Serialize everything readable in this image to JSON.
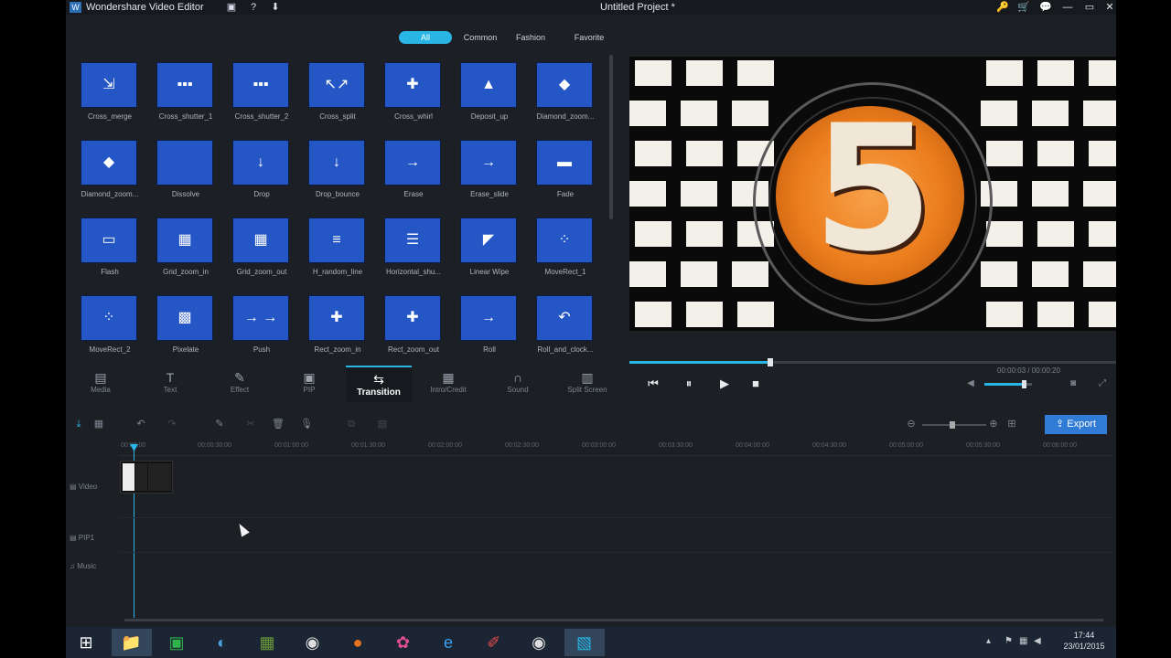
{
  "titlebar": {
    "app_name": "Wondershare Video Editor",
    "project": "Untitled Project *",
    "right_buttons": [
      "🔑",
      "🛒",
      "💬",
      "—",
      "▭",
      "✕"
    ]
  },
  "filters": [
    "All",
    "Common",
    "Fashion",
    "Favorite"
  ],
  "active_filter": "All",
  "transitions": [
    {
      "label": "Cross_merge",
      "glyph": "⇲"
    },
    {
      "label": "Cross_shutter_1",
      "glyph": "▪▪▪"
    },
    {
      "label": "Cross_shutter_2",
      "glyph": "▪▪▪"
    },
    {
      "label": "Cross_split",
      "glyph": "↖↗"
    },
    {
      "label": "Cross_whirl",
      "glyph": "✚"
    },
    {
      "label": "Deposit_up",
      "glyph": "▲"
    },
    {
      "label": "Diamond_zoom...",
      "glyph": "◆"
    },
    {
      "label": "Diamond_zoom...",
      "glyph": "◆"
    },
    {
      "label": "Dissolve",
      "glyph": ""
    },
    {
      "label": "Drop",
      "glyph": "↓"
    },
    {
      "label": "Drop_bounce",
      "glyph": "↓"
    },
    {
      "label": "Erase",
      "glyph": "→"
    },
    {
      "label": "Erase_slide",
      "glyph": "→"
    },
    {
      "label": "Fade",
      "glyph": "▬"
    },
    {
      "label": "Flash",
      "glyph": "▭"
    },
    {
      "label": "Grid_zoom_in",
      "glyph": "▦"
    },
    {
      "label": "Grid_zoom_out",
      "glyph": "▦"
    },
    {
      "label": "H_random_line",
      "glyph": "≡"
    },
    {
      "label": "Horizontal_shu...",
      "glyph": "☰"
    },
    {
      "label": "Linear Wipe",
      "glyph": "◤"
    },
    {
      "label": "MoveRect_1",
      "glyph": "⁘"
    },
    {
      "label": "MoveRect_2",
      "glyph": "⁘"
    },
    {
      "label": "Pixelate",
      "glyph": "▩"
    },
    {
      "label": "Push",
      "glyph": "→ →"
    },
    {
      "label": "Rect_zoom_in",
      "glyph": "✚"
    },
    {
      "label": "Rect_zoom_out",
      "glyph": "✚"
    },
    {
      "label": "Roll",
      "glyph": "→"
    },
    {
      "label": "Roll_and_clock...",
      "glyph": "↶"
    }
  ],
  "tools": [
    {
      "label": "Media",
      "glyph": "▤"
    },
    {
      "label": "Text",
      "glyph": "T"
    },
    {
      "label": "Effect",
      "glyph": "✎"
    },
    {
      "label": "PIP",
      "glyph": "▣"
    },
    {
      "label": "Transition",
      "glyph": "⇆"
    },
    {
      "label": "Intro/Credit",
      "glyph": "▦"
    },
    {
      "label": "Sound",
      "glyph": "∩"
    },
    {
      "label": "Split Screen",
      "glyph": "▥"
    }
  ],
  "active_tool": "Transition",
  "player": {
    "countdown_digit": "5",
    "timecode": "00:00:03 / 00:00:20",
    "progress": 0.29,
    "volume": 0.85,
    "controls": [
      "⏮",
      "⏸",
      "▶",
      "■"
    ]
  },
  "timeline": {
    "export_label": "Export",
    "ruler_ticks": [
      "00:00:00",
      "00:00:30:00",
      "00:01:00:00",
      "00:01:30:00",
      "00:02:00:00",
      "00:02:30:00",
      "00:03:00:00",
      "00:03:30:00",
      "00:04:00:00",
      "00:04:30:00",
      "00:05:00:00",
      "00:05:30:00",
      "00:06:00:00"
    ],
    "tracks": [
      "Video",
      "PIP1",
      "Music"
    ]
  },
  "taskbar": {
    "apps": [
      "⊞",
      "📁",
      "▣",
      "◐",
      "▦",
      "◉",
      "●",
      "✿",
      "e",
      "✐",
      "◉",
      "▧"
    ],
    "time": "17:44",
    "date": "23/01/2015"
  }
}
